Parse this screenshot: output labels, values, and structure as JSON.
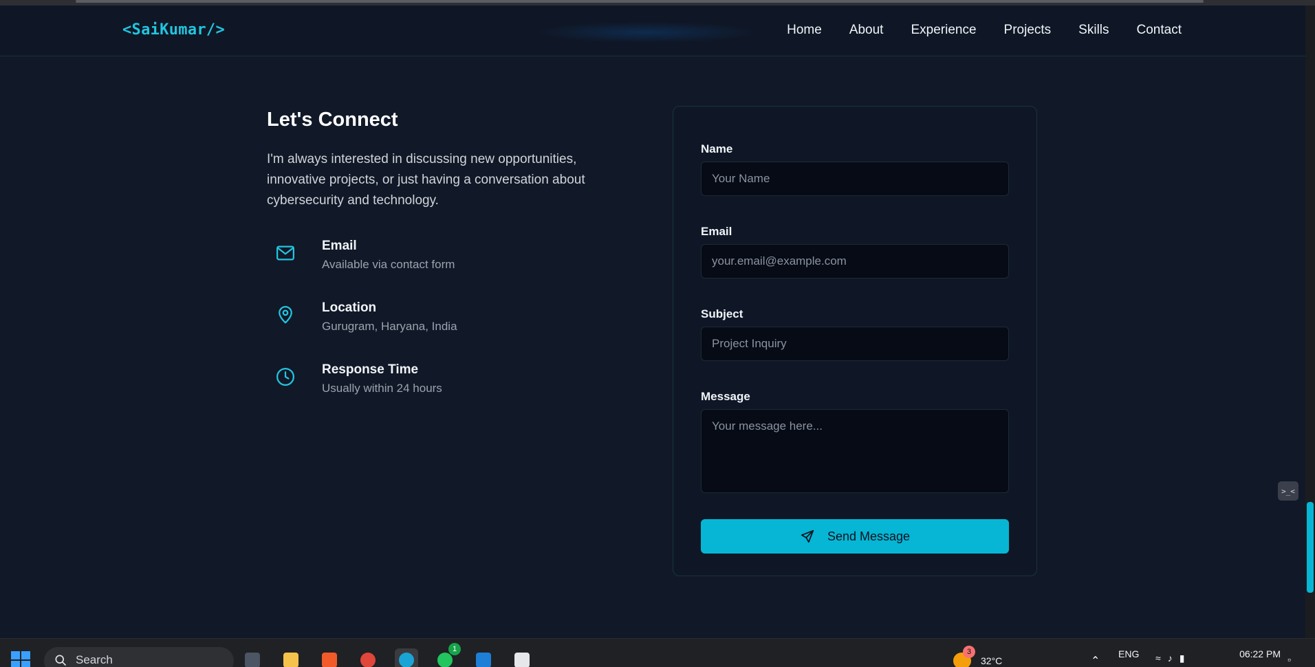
{
  "nav": {
    "logo": "<SaiKumar/>",
    "links": [
      "Home",
      "About",
      "Experience",
      "Projects",
      "Skills",
      "Contact"
    ]
  },
  "contact": {
    "heading": "Let's Connect",
    "intro": "I'm always interested in discussing new opportunities, innovative projects, or just having a conversation about cybersecurity and technology.",
    "info": [
      {
        "icon": "mail-icon",
        "title": "Email",
        "subtitle": "Available via contact form"
      },
      {
        "icon": "map-pin-icon",
        "title": "Location",
        "subtitle": "Gurugram, Haryana, India"
      },
      {
        "icon": "clock-icon",
        "title": "Response Time",
        "subtitle": "Usually within 24 hours"
      }
    ]
  },
  "form": {
    "name_label": "Name",
    "name_placeholder": "Your Name",
    "email_label": "Email",
    "email_placeholder": "your.email@example.com",
    "subject_label": "Subject",
    "subject_placeholder": "Project Inquiry",
    "message_label": "Message",
    "message_placeholder": "Your message here...",
    "submit_label": "Send Message"
  },
  "floating_button": ">_<",
  "taskbar": {
    "search_placeholder": "Search",
    "whatsapp_badge": "1",
    "weather_badge": "3",
    "temperature": "32°C",
    "language": "ENG",
    "time": "06:22 PM"
  },
  "colors": {
    "accent": "#06b6d4",
    "background": "#111827",
    "input_bg": "#060b16"
  }
}
